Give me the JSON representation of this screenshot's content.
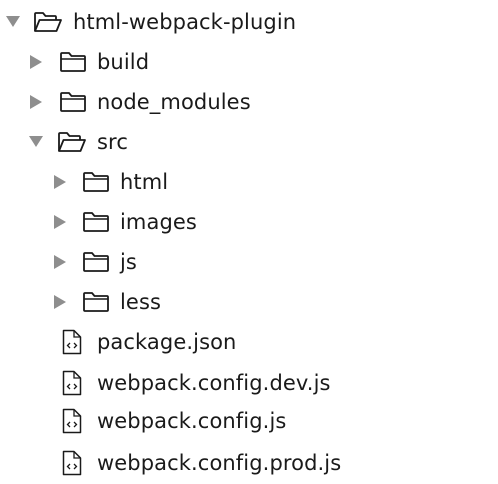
{
  "tree": {
    "root": {
      "label": "html-webpack-plugin",
      "state": "expanded",
      "icon": "folder-open-icon"
    },
    "build": {
      "label": "build",
      "state": "collapsed",
      "icon": "folder-icon"
    },
    "node_modules": {
      "label": "node_modules",
      "state": "collapsed",
      "icon": "folder-icon"
    },
    "src": {
      "label": "src",
      "state": "expanded",
      "icon": "folder-open-icon"
    },
    "html": {
      "label": "html",
      "state": "collapsed",
      "icon": "folder-icon"
    },
    "images": {
      "label": "images",
      "state": "collapsed",
      "icon": "folder-icon"
    },
    "js": {
      "label": "js",
      "state": "collapsed",
      "icon": "folder-icon"
    },
    "less": {
      "label": "less",
      "state": "collapsed",
      "icon": "folder-icon"
    },
    "package_json": {
      "label": "package.json",
      "icon": "code-file-icon"
    },
    "webpack_config_dev": {
      "label": "webpack.config.dev.js",
      "icon": "code-file-icon"
    },
    "webpack_config": {
      "label": "webpack.config.js",
      "icon": "code-file-icon"
    },
    "webpack_config_prod": {
      "label": "webpack.config.prod.js",
      "icon": "code-file-icon"
    }
  },
  "colors": {
    "arrow": "#8e8e8e",
    "icon_stroke": "#1a1a1a",
    "text": "#1a1a1a",
    "background": "#ffffff"
  }
}
